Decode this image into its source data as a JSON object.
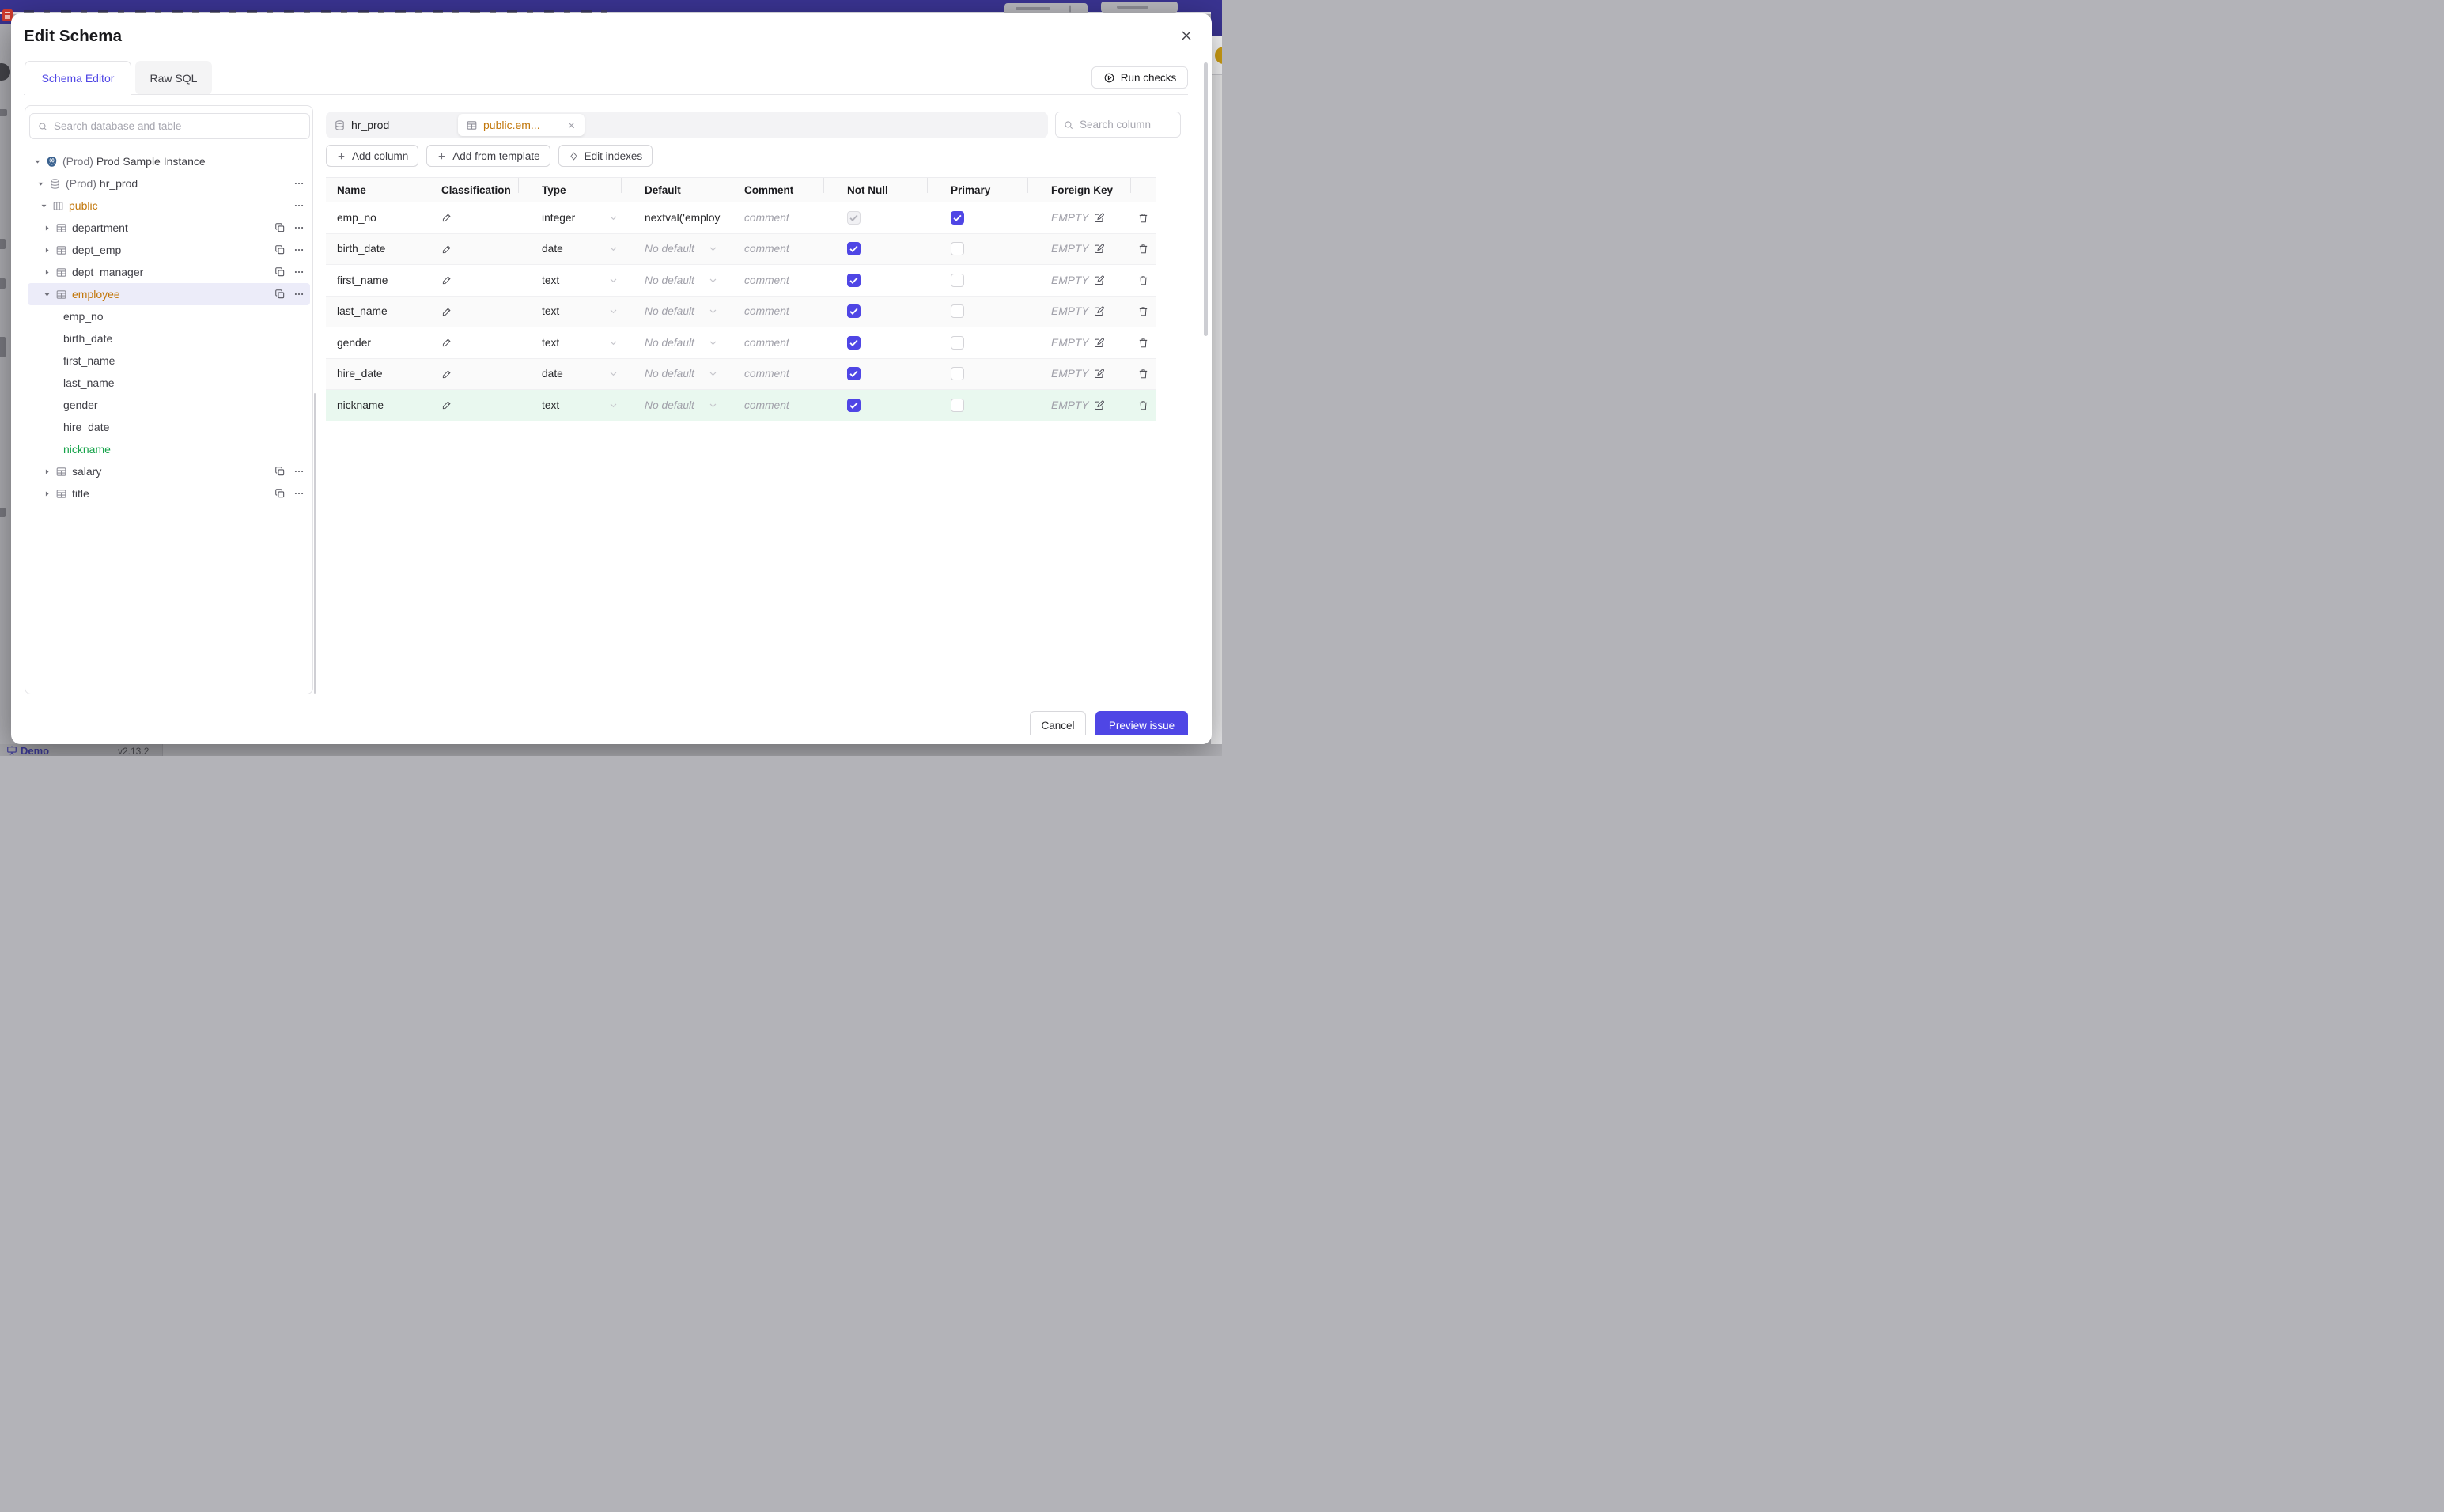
{
  "app": {
    "accent_color": "#4f46e5",
    "amber_color": "#c2770b",
    "green_color": "#16a34a",
    "topbar_color": "#3a3492"
  },
  "modal": {
    "title": "Edit Schema",
    "tabs": [
      {
        "label": "Schema Editor",
        "active": true
      },
      {
        "label": "Raw SQL",
        "active": false
      }
    ],
    "run_checks_label": "Run checks",
    "footer": {
      "cancel_label": "Cancel",
      "preview_label": "Preview issue"
    }
  },
  "sidebar": {
    "search_placeholder": "Search database and table",
    "tree": [
      {
        "type": "instance",
        "icon": "postgres-icon",
        "caret": "down",
        "prefix": "(Prod)",
        "label": "Prod Sample Instance"
      },
      {
        "type": "database",
        "icon": "database-icon",
        "caret": "down",
        "prefix": "(Prod)",
        "label": "hr_prod",
        "menu": true
      },
      {
        "type": "schema",
        "icon": "schema-icon",
        "caret": "down",
        "label": "public",
        "accent": "amber",
        "menu": true
      },
      {
        "type": "table",
        "icon": "table-icon",
        "caret": "right",
        "label": "department",
        "copy": true,
        "menu": true
      },
      {
        "type": "table",
        "icon": "table-icon",
        "caret": "right",
        "label": "dept_emp",
        "copy": true,
        "menu": true
      },
      {
        "type": "table",
        "icon": "table-icon",
        "caret": "right",
        "label": "dept_manager",
        "copy": true,
        "menu": true
      },
      {
        "type": "table",
        "icon": "table-icon",
        "caret": "down",
        "label": "employee",
        "accent": "amber",
        "selected": true,
        "copy": true,
        "menu": true
      },
      {
        "type": "column",
        "label": "emp_no"
      },
      {
        "type": "column",
        "label": "birth_date"
      },
      {
        "type": "column",
        "label": "first_name"
      },
      {
        "type": "column",
        "label": "last_name"
      },
      {
        "type": "column",
        "label": "gender"
      },
      {
        "type": "column",
        "label": "hire_date"
      },
      {
        "type": "column",
        "label": "nickname",
        "accent": "green"
      },
      {
        "type": "table",
        "icon": "table-icon",
        "caret": "right",
        "label": "salary",
        "copy": true,
        "menu": true
      },
      {
        "type": "table",
        "icon": "table-icon",
        "caret": "right",
        "label": "title",
        "copy": true,
        "menu": true
      }
    ]
  },
  "editor": {
    "chips": [
      {
        "label": "hr_prod",
        "icon": "database-icon",
        "active": false
      },
      {
        "label": "public.em...",
        "icon": "table-icon",
        "active": true
      }
    ],
    "column_search_placeholder": "Search column",
    "toolbar": [
      {
        "label": "Add column",
        "icon": "plus-icon"
      },
      {
        "label": "Add from template",
        "icon": "plus-icon"
      },
      {
        "label": "Edit indexes",
        "icon": "diamond-icon"
      }
    ],
    "table": {
      "headers": [
        "Name",
        "Classification",
        "Type",
        "Default",
        "Comment",
        "Not Null",
        "Primary",
        "Foreign Key"
      ],
      "comment_placeholder": "comment",
      "fk_empty_label": "EMPTY",
      "rows": [
        {
          "name": "emp_no",
          "type": "integer",
          "default": "nextval('employ",
          "default_muted": false,
          "not_null": true,
          "not_null_disabled": true,
          "primary": true,
          "highlight": null
        },
        {
          "name": "birth_date",
          "type": "date",
          "default": "No default",
          "default_muted": true,
          "not_null": true,
          "not_null_disabled": false,
          "primary": false,
          "highlight": null
        },
        {
          "name": "first_name",
          "type": "text",
          "default": "No default",
          "default_muted": true,
          "not_null": true,
          "not_null_disabled": false,
          "primary": false,
          "highlight": null
        },
        {
          "name": "last_name",
          "type": "text",
          "default": "No default",
          "default_muted": true,
          "not_null": true,
          "not_null_disabled": false,
          "primary": false,
          "highlight": null
        },
        {
          "name": "gender",
          "type": "text",
          "default": "No default",
          "default_muted": true,
          "not_null": true,
          "not_null_disabled": false,
          "primary": false,
          "highlight": null
        },
        {
          "name": "hire_date",
          "type": "date",
          "default": "No default",
          "default_muted": true,
          "not_null": true,
          "not_null_disabled": false,
          "primary": false,
          "highlight": null
        },
        {
          "name": "nickname",
          "type": "text",
          "default": "No default",
          "default_muted": true,
          "not_null": true,
          "not_null_disabled": false,
          "primary": false,
          "highlight": "green"
        }
      ]
    }
  },
  "page_footer": {
    "demo_label": "Demo",
    "version": "v2.13.2"
  }
}
